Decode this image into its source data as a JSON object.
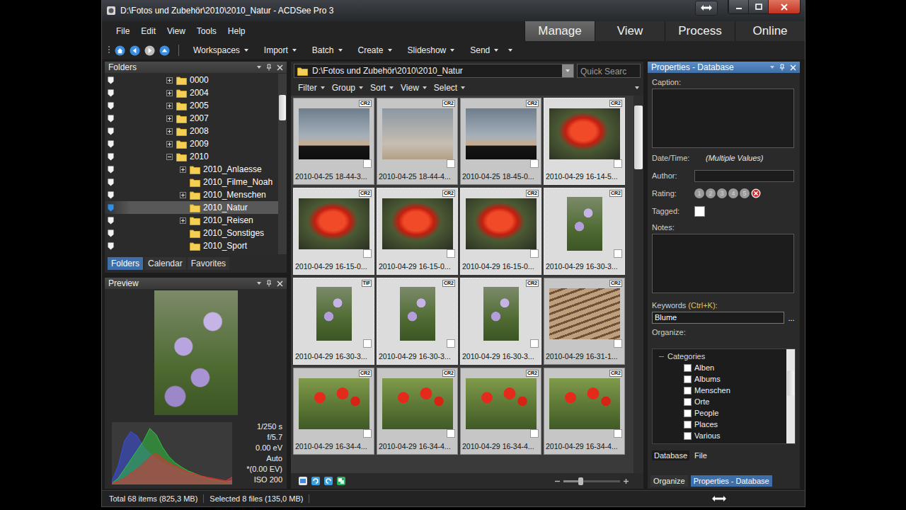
{
  "window": {
    "title": "D:\\Fotos und Zubehör\\2010\\2010_Natur - ACDSee Pro 3"
  },
  "menu": [
    "File",
    "Edit",
    "View",
    "Tools",
    "Help"
  ],
  "modes": [
    {
      "label": "Manage",
      "selected": true
    },
    {
      "label": "View",
      "selected": false
    },
    {
      "label": "Process",
      "selected": false
    },
    {
      "label": "Online",
      "selected": false
    }
  ],
  "toolbar": [
    "Workspaces",
    "Import",
    "Batch",
    "Create",
    "Slideshow",
    "Send"
  ],
  "folders_panel": {
    "title": "Folders",
    "tree": [
      {
        "label": "0000",
        "level": 0,
        "has_children": true,
        "expanded": false,
        "selected": false
      },
      {
        "label": "2004",
        "level": 0,
        "has_children": true,
        "expanded": false,
        "selected": false
      },
      {
        "label": "2005",
        "level": 0,
        "has_children": true,
        "expanded": false,
        "selected": false
      },
      {
        "label": "2007",
        "level": 0,
        "has_children": true,
        "expanded": false,
        "selected": false
      },
      {
        "label": "2008",
        "level": 0,
        "has_children": true,
        "expanded": false,
        "selected": false
      },
      {
        "label": "2009",
        "level": 0,
        "has_children": true,
        "expanded": false,
        "selected": false
      },
      {
        "label": "2010",
        "level": 0,
        "has_children": true,
        "expanded": true,
        "selected": false
      },
      {
        "label": "2010_Anlaesse",
        "level": 1,
        "has_children": true,
        "expanded": false,
        "selected": false
      },
      {
        "label": "2010_Filme_Noah",
        "level": 1,
        "has_children": false,
        "expanded": false,
        "selected": false
      },
      {
        "label": "2010_Menschen",
        "level": 1,
        "has_children": true,
        "expanded": false,
        "selected": false
      },
      {
        "label": "2010_Natur",
        "level": 1,
        "has_children": false,
        "expanded": false,
        "selected": true
      },
      {
        "label": "2010_Reisen",
        "level": 1,
        "has_children": true,
        "expanded": false,
        "selected": false
      },
      {
        "label": "2010_Sonstiges",
        "level": 1,
        "has_children": false,
        "expanded": false,
        "selected": false
      },
      {
        "label": "2010_Sport",
        "level": 1,
        "has_children": false,
        "expanded": false,
        "selected": false
      }
    ],
    "tabs": [
      {
        "label": "Folders",
        "selected": true
      },
      {
        "label": "Calendar",
        "selected": false
      },
      {
        "label": "Favorites",
        "selected": false
      }
    ]
  },
  "preview_panel": {
    "title": "Preview",
    "exif": [
      "1/250 s",
      "f/5.7",
      "0.00 eV",
      "Auto",
      "*(0.00 EV)",
      "ISO 200"
    ],
    "histogram": [
      {
        "name": "Blue",
        "color": "#3a4ee0",
        "values": [
          5,
          30,
          70,
          85,
          78,
          60,
          50,
          40,
          35,
          30,
          26,
          22,
          18,
          15,
          12,
          10,
          8,
          6,
          5,
          8
        ]
      },
      {
        "name": "Green",
        "color": "#2fc040",
        "values": [
          2,
          10,
          25,
          40,
          55,
          70,
          90,
          80,
          60,
          45,
          35,
          28,
          22,
          18,
          14,
          10,
          8,
          6,
          4,
          6
        ]
      },
      {
        "name": "Red",
        "color": "#e03030",
        "values": [
          2,
          5,
          10,
          18,
          25,
          35,
          45,
          50,
          42,
          35,
          30,
          25,
          20,
          17,
          14,
          12,
          10,
          8,
          6,
          12
        ]
      }
    ]
  },
  "browser": {
    "path": "D:\\Fotos und Zubehör\\2010\\2010_Natur",
    "search_placeholder": "Quick Searc",
    "filter_bar": [
      "Filter",
      "Group",
      "Sort",
      "View",
      "Select"
    ],
    "thumbnails": [
      {
        "label": "2010-04-25 18-44-3...",
        "badge": "CR2",
        "kind": "crane",
        "selected": false,
        "tagged": false
      },
      {
        "label": "2010-04-25 18-44-4...",
        "badge": "CR2",
        "kind": "sky",
        "selected": false,
        "tagged": false
      },
      {
        "label": "2010-04-25 18-45-0...",
        "badge": "CR2",
        "kind": "crane",
        "selected": false,
        "tagged": false
      },
      {
        "label": "2010-04-29 16-14-5...",
        "badge": "CR2",
        "kind": "tulip",
        "selected": true,
        "tagged": false
      },
      {
        "label": "2010-04-29 16-15-0...",
        "badge": "CR2",
        "kind": "tulip",
        "selected": true,
        "tagged": false
      },
      {
        "label": "2010-04-29 16-15-0...",
        "badge": "CR2",
        "kind": "tulip",
        "selected": true,
        "tagged": false
      },
      {
        "label": "2010-04-29 16-15-0...",
        "badge": "CR2",
        "kind": "tulip",
        "selected": true,
        "tagged": false
      },
      {
        "label": "2010-04-29 16-30-3...",
        "badge": "CR2",
        "kind": "phlox",
        "selected": true,
        "tagged": false
      },
      {
        "label": "2010-04-29 16-30-3...",
        "badge": "TIF",
        "kind": "phlox",
        "selected": true,
        "tagged": false
      },
      {
        "label": "2010-04-29 16-30-3...",
        "badge": "CR2",
        "kind": "phlox",
        "selected": true,
        "tagged": false
      },
      {
        "label": "2010-04-29 16-30-3...",
        "badge": "CR2",
        "kind": "phlox",
        "selected": true,
        "tagged": false
      },
      {
        "label": "2010-04-29 16-31-1...",
        "badge": "CR2",
        "kind": "tiles",
        "selected": false,
        "tagged": false
      },
      {
        "label": "2010-04-29 16-34-4...",
        "badge": "CR2",
        "kind": "tulips",
        "selected": false,
        "tagged": false
      },
      {
        "label": "2010-04-29 16-34-4...",
        "badge": "CR2",
        "kind": "tulips",
        "selected": false,
        "tagged": false
      },
      {
        "label": "2010-04-29 16-34-4...",
        "badge": "CR2",
        "kind": "tulips",
        "selected": false,
        "tagged": false
      },
      {
        "label": "2010-04-29 16-34-4...",
        "badge": "CR2",
        "kind": "tulips",
        "selected": false,
        "tagged": false
      }
    ],
    "zoom": {
      "level": 0.3
    }
  },
  "properties": {
    "title": "Properties - Database",
    "caption_label": "Caption:",
    "datetime_label": "Date/Time:",
    "datetime_value": "(Multiple Values)",
    "author_label": "Author:",
    "rating_label": "Rating:",
    "rating_values": [
      "1",
      "2",
      "3",
      "4",
      "5"
    ],
    "stars": 0,
    "tagged_label": "Tagged:",
    "tagged": false,
    "notes_label": "Notes:",
    "keywords_label": "Keywords",
    "keywords_hint": "(Ctrl+K):",
    "keywords_value": "Blume",
    "keywords_button": "...",
    "organize_label": "Organize:",
    "categories": {
      "label": "Categories",
      "expanded": true,
      "items": [
        {
          "label": "Alben",
          "checked": false
        },
        {
          "label": "Albums",
          "checked": false
        },
        {
          "label": "Menschen",
          "checked": false
        },
        {
          "label": "Orte",
          "checked": false
        },
        {
          "label": "People",
          "checked": false
        },
        {
          "label": "Places",
          "checked": false
        },
        {
          "label": "Various",
          "checked": false
        }
      ]
    },
    "tabs": [
      {
        "label": "Database",
        "selected": true
      },
      {
        "label": "File",
        "selected": false
      }
    ]
  },
  "bottom_tabs": [
    {
      "label": "Organize",
      "selected": false
    },
    {
      "label": "Properties - Database",
      "selected": true
    }
  ],
  "status_bar": [
    "Total 68 items (825,3 MB)",
    "Selected 8 files (135,0 MB)"
  ]
}
